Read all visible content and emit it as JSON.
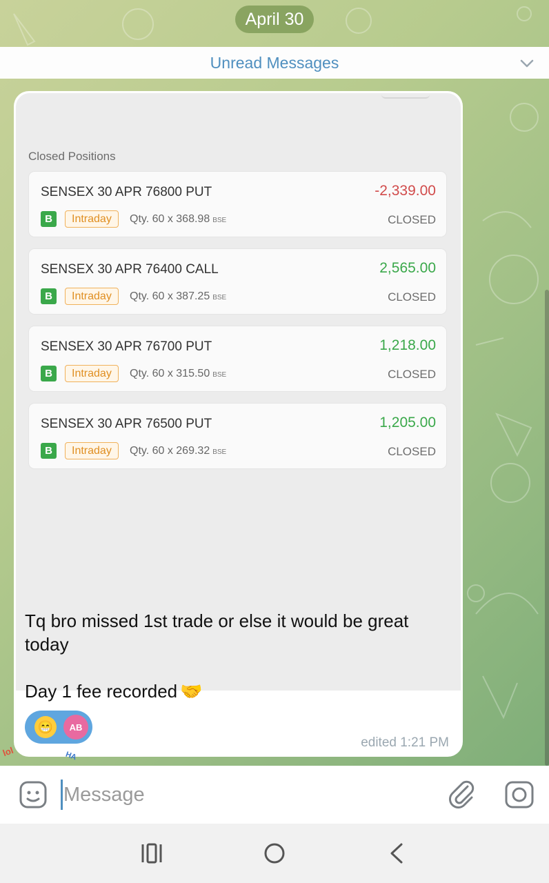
{
  "date_pill": "April 30",
  "unread_bar": {
    "label": "Unread Messages"
  },
  "photo": {
    "section_title": "Closed Positions",
    "positions": [
      {
        "name": "SENSEX 30 APR 76800 PUT",
        "pnl": "-2,339.00",
        "pnl_sign": "neg",
        "side": "B",
        "product": "Intraday",
        "qty": "Qty. 60 x 368.98",
        "exchange": "BSE",
        "status": "CLOSED"
      },
      {
        "name": "SENSEX 30 APR 76400 CALL",
        "pnl": "2,565.00",
        "pnl_sign": "pos",
        "side": "B",
        "product": "Intraday",
        "qty": "Qty. 60 x 387.25",
        "exchange": "BSE",
        "status": "CLOSED"
      },
      {
        "name": "SENSEX 30 APR 76700 PUT",
        "pnl": "1,218.00",
        "pnl_sign": "pos",
        "side": "B",
        "product": "Intraday",
        "qty": "Qty. 60 x 315.50",
        "exchange": "BSE",
        "status": "CLOSED"
      },
      {
        "name": "SENSEX 30 APR 76500 PUT",
        "pnl": "1,205.00",
        "pnl_sign": "pos",
        "side": "B",
        "product": "Intraday",
        "qty": "Qty. 60 x 269.32",
        "exchange": "BSE",
        "status": "CLOSED"
      }
    ]
  },
  "message": {
    "line1": "Tq bro missed 1st trade or else it would be great today",
    "line2": "Day 1 fee recorded",
    "line2_emoji": "🤝",
    "time": "edited 1:21 PM",
    "reaction": {
      "emoji": "😁",
      "avatar_initials": "AB"
    }
  },
  "stickers": {
    "left": "lol",
    "right": "HA"
  },
  "composer": {
    "placeholder": "Message"
  },
  "colors": {
    "accent": "#4f8fbf",
    "profit": "#3aa84a",
    "loss": "#d14b4b",
    "intraday": "#e08f22"
  }
}
